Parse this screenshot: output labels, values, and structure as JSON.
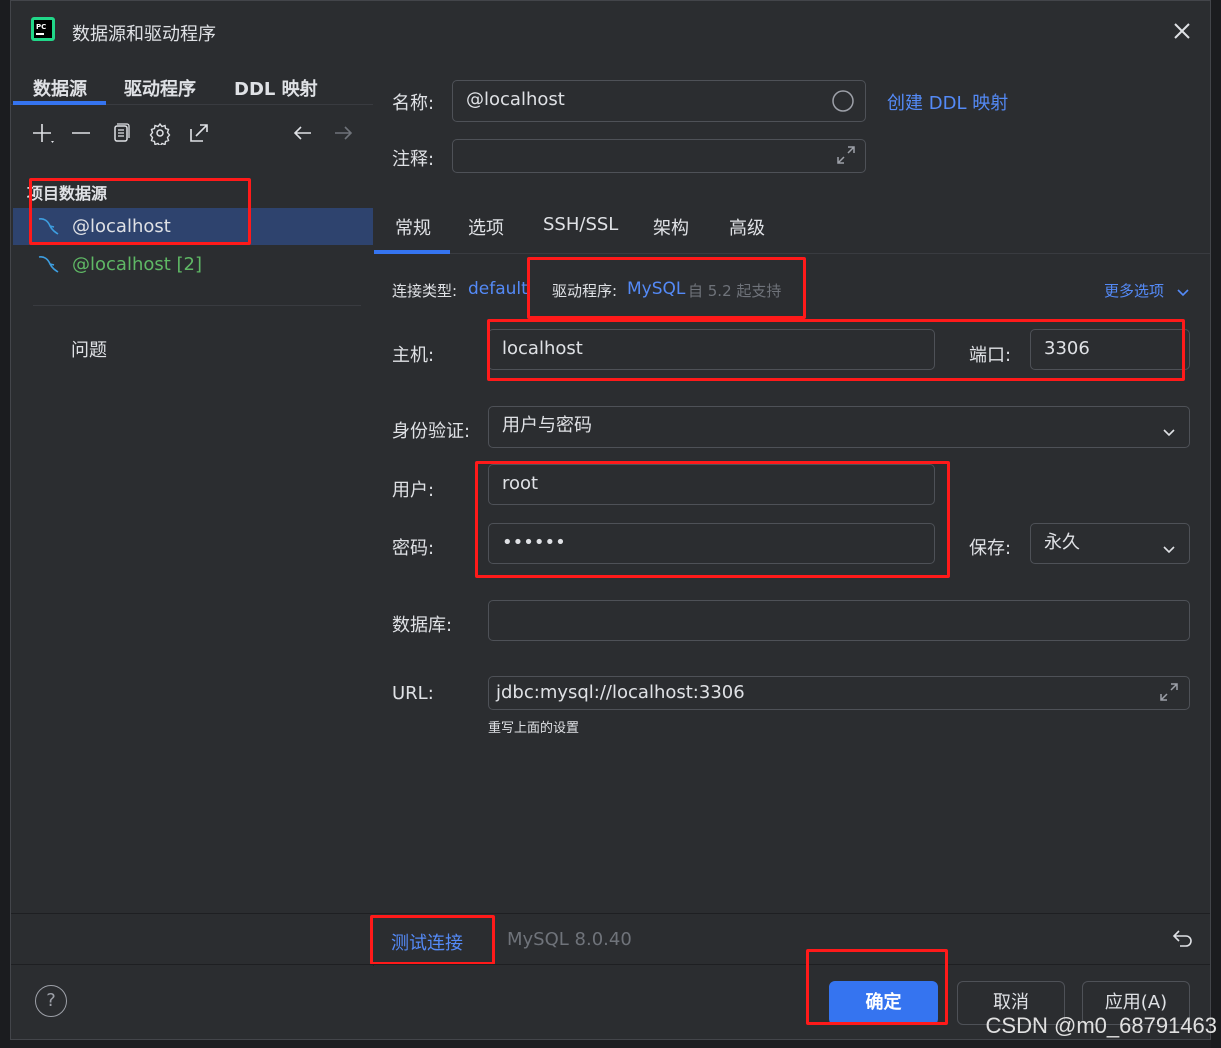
{
  "window": {
    "title": "数据源和驱动程序"
  },
  "left": {
    "tabs": [
      "数据源",
      "驱动程序",
      "DDL 映射"
    ],
    "group_header": "项目数据源",
    "items": [
      {
        "label": "@localhost",
        "selected": true
      },
      {
        "label": "@localhost [2]",
        "selected": false
      }
    ],
    "problems_label": "问题"
  },
  "form": {
    "name_label": "名称:",
    "name_value": "@localhost",
    "create_ddl_link": "创建 DDL 映射",
    "comment_label": "注释:",
    "comment_value": "",
    "tabs": [
      "常规",
      "选项",
      "SSH/SSL",
      "架构",
      "高级"
    ],
    "conn_type_label": "连接类型:",
    "conn_type_value": "default",
    "driver_label": "驱动程序:",
    "driver_value": "MySQL",
    "driver_note": "自 5.2 起支持",
    "more_options": "更多选项",
    "host_label": "主机:",
    "host_value": "localhost",
    "port_label": "端口:",
    "port_value": "3306",
    "auth_label": "身份验证:",
    "auth_value": "用户与密码",
    "user_label": "用户:",
    "user_value": "root",
    "password_label": "密码:",
    "password_value": "••••••",
    "save_label": "保存:",
    "save_value": "永久",
    "database_label": "数据库:",
    "database_value": "",
    "url_label": "URL:",
    "url_value": "jdbc:mysql://localhost:3306",
    "url_hint": "重写上面的设置"
  },
  "status": {
    "test_connection": "测试连接",
    "server_version": "MySQL 8.0.40"
  },
  "footer": {
    "help": "?",
    "ok": "确定",
    "cancel": "取消",
    "apply": "应用(A)"
  },
  "watermark": "CSDN @m0_68791463",
  "colors": {
    "accent": "#3574f0",
    "link": "#548af7",
    "annotation": "#ff1a1a",
    "green_item": "#5fb865"
  }
}
